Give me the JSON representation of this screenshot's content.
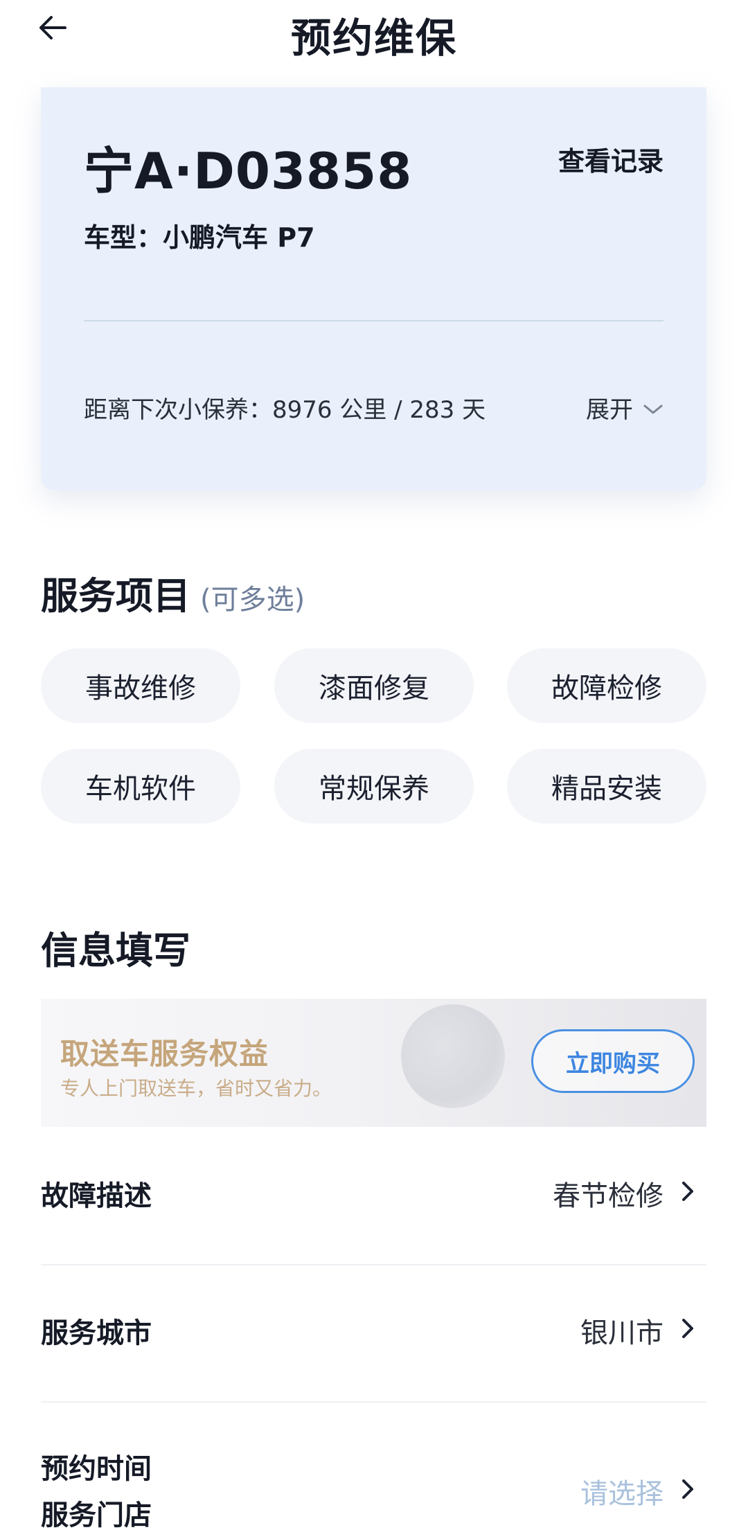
{
  "header": {
    "title": "预约维保"
  },
  "vehicle": {
    "plate": "宁A·D03858",
    "view_records": "查看记录",
    "model": "车型：小鹏汽车 P7",
    "next_service": "距离下次小保养：8976 公里 / 283 天",
    "expand_label": "展开"
  },
  "services": {
    "title": "服务项目",
    "hint": "(可多选)",
    "items": [
      "事故维修",
      "漆面修复",
      "故障检修",
      "车机软件",
      "常规保养",
      "精品安装"
    ]
  },
  "info": {
    "title": "信息填写",
    "promo": {
      "title": "取送车服务权益",
      "subtitle": "专人上门取送车，省时又省力。",
      "button": "立即购买"
    },
    "rows": [
      {
        "label": "故障描述",
        "value": "春节检修"
      },
      {
        "label": "服务城市",
        "value": "银川市"
      },
      {
        "label": "预约时间",
        "value": "请选择"
      },
      {
        "label": "服务门店"
      }
    ]
  },
  "colors": {
    "card_bg": "#e9f0fb",
    "chip_bg": "#f4f5f8",
    "promo_gold": "#c5a57b",
    "accent_blue": "#3d86e0",
    "hint_gray": "#6e7f9b",
    "placeholder": "#a9c1dc"
  },
  "icons": {
    "back": "arrow-left-icon",
    "expand": "chevron-down-icon",
    "row_arrow": "chevron-right-icon"
  }
}
